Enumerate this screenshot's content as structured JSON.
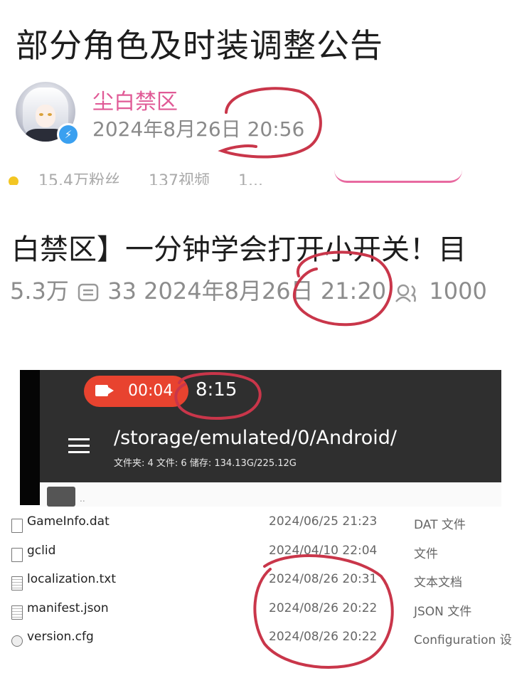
{
  "post": {
    "title": "部分角色及时装调整公告",
    "author": "尘白禁区",
    "time": "2024年8月26日 20:56",
    "stats_followers": "15.4万粉丝",
    "stats_videos": "137视频",
    "stats_more": "1..."
  },
  "video": {
    "title": "白禁区】一分钟学会打开小开关！目",
    "views": "5.3万",
    "comments": "33",
    "date": "2024年8月26日 21:20",
    "viewers": "1000"
  },
  "phone": {
    "rec_time": "00:04",
    "clock": "8:15",
    "path": "/storage/emulated/0/Android/",
    "info": "文件夹: 4  文件: 6  储存: 134.13G/225.12G",
    "folder_dots": ".."
  },
  "files": [
    {
      "name": "GameInfo.dat",
      "date": "2024/06/25 21:23",
      "type": "DAT 文件",
      "icon": "file-icon"
    },
    {
      "name": "gclid",
      "date": "2024/04/10 22:04",
      "type": "文件",
      "icon": "file-icon"
    },
    {
      "name": "localization.txt",
      "date": "2024/08/26 20:31",
      "type": "文本文档",
      "icon": "text-file-icon"
    },
    {
      "name": "manifest.json",
      "date": "2024/08/26 20:22",
      "type": "JSON 文件",
      "icon": "text-file-icon"
    },
    {
      "name": "version.cfg",
      "date": "2024/08/26 20:22",
      "type": "Configuration 设",
      "icon": "config-file-icon"
    }
  ],
  "colors": {
    "author": "#e05a96",
    "annotation": "#c9364a",
    "recording": "#e8432f"
  }
}
